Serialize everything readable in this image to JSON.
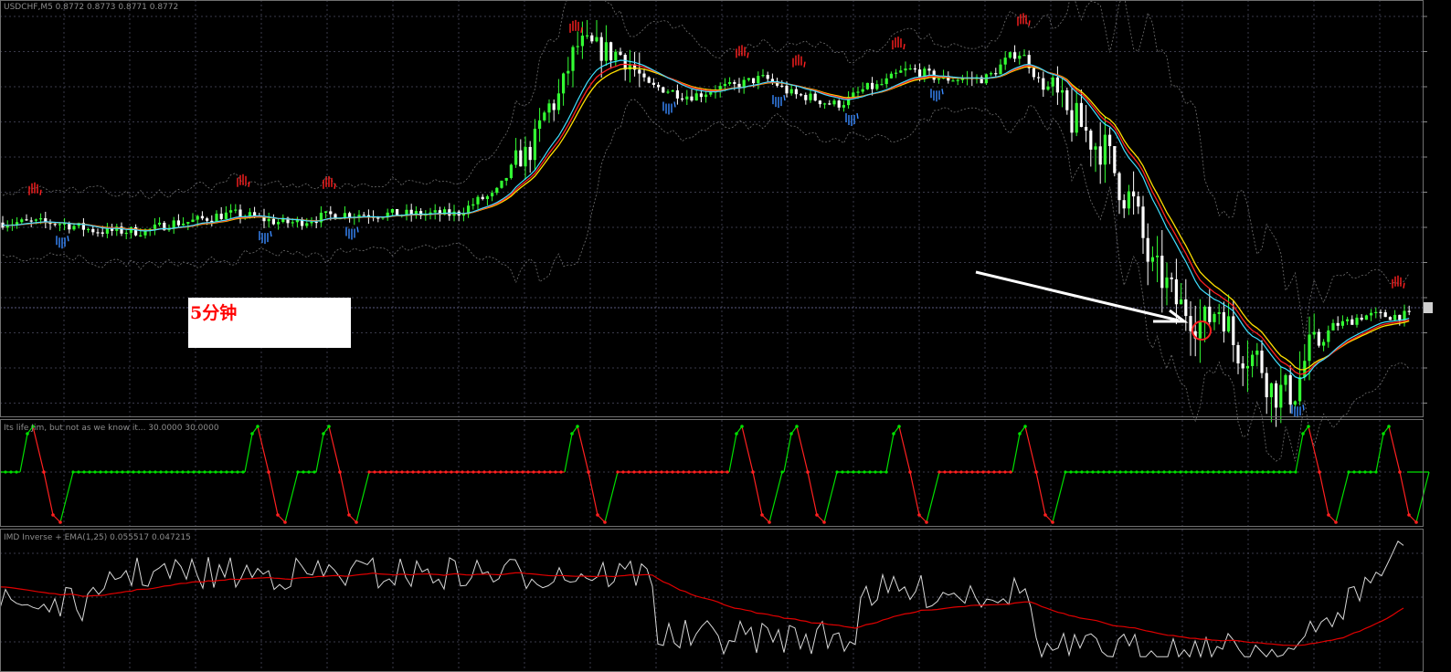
{
  "symbol_header": "USDCHF,M5  0.8772 0.8773 0.8771 0.8772",
  "overlay_text": "5分钟",
  "panel2_title": "Its life Jim, but not as we know it...  30.0000 30.0000",
  "panel3_title": "IMD Inverse + EMA(1,25) 0.055517 0.047215",
  "colors": {
    "background": "#000000",
    "grid": "#3a3a4a",
    "bull": "#33ff33",
    "bear": "#ffffff",
    "ma_fast": "#ff2020",
    "ma_slow": "#ffe000",
    "ma_cyan": "#40e0ff",
    "band": "#707070",
    "osc_up": "#00e000",
    "osc_down": "#ff2020",
    "line_white": "#d8d8d8",
    "line_red": "#e00000"
  },
  "chart_data": [
    {
      "type": "candlestick",
      "title": "USDCHF,M5",
      "series": [
        {
          "name": "price"
        },
        {
          "name": "MA"
        },
        {
          "name": "Bands"
        }
      ],
      "anchors": [
        [
          0,
          0.8772
        ],
        [
          60,
          0.8772
        ],
        [
          120,
          0.8771
        ],
        [
          160,
          0.8771
        ],
        [
          200,
          0.8772
        ],
        [
          260,
          0.8773
        ],
        [
          320,
          0.8772
        ],
        [
          380,
          0.8773
        ],
        [
          440,
          0.8773
        ],
        [
          500,
          0.8773
        ],
        [
          540,
          0.8775
        ],
        [
          580,
          0.878
        ],
        [
          610,
          0.8786
        ],
        [
          640,
          0.8793
        ],
        [
          680,
          0.8792
        ],
        [
          720,
          0.8788
        ],
        [
          760,
          0.8787
        ],
        [
          800,
          0.8788
        ],
        [
          840,
          0.8789
        ],
        [
          880,
          0.8787
        ],
        [
          920,
          0.8786
        ],
        [
          960,
          0.8788
        ],
        [
          1000,
          0.879
        ],
        [
          1040,
          0.8789
        ],
        [
          1080,
          0.8789
        ],
        [
          1120,
          0.8792
        ],
        [
          1150,
          0.8788
        ],
        [
          1180,
          0.8784
        ],
        [
          1210,
          0.8781
        ],
        [
          1240,
          0.8775
        ],
        [
          1270,
          0.8766
        ],
        [
          1300,
          0.8762
        ],
        [
          1320,
          0.876
        ],
        [
          1340,
          0.8762
        ],
        [
          1360,
          0.8757
        ],
        [
          1380,
          0.8756
        ],
        [
          1400,
          0.8752
        ],
        [
          1420,
          0.8752
        ],
        [
          1440,
          0.8757
        ],
        [
          1470,
          0.876
        ],
        [
          1500,
          0.8761
        ],
        [
          1540,
          0.8761
        ]
      ],
      "highs": [
        28,
        31,
        34,
        82,
        128,
        187,
        198,
        222,
        229,
        232,
        235,
        238,
        241,
        304,
        316,
        353,
        360
      ],
      "lows": [
        14,
        63,
        78,
        92,
        135,
        151,
        163,
        206,
        219,
        260,
        267,
        325,
        385,
        427,
        433,
        436,
        485,
        503,
        528,
        549,
        559
      ],
      "red_circle_at_x": 1315
    },
    {
      "type": "step",
      "title": "Its life Jim, but not as we know it...",
      "levels": [
        30.0,
        30.0
      ],
      "ylim": [
        0,
        100
      ]
    },
    {
      "type": "line",
      "title": "IMD Inverse + EMA(1,25)",
      "series": [
        {
          "name": "IMD Inverse",
          "value": 0.055517
        },
        {
          "name": "EMA(1,25)",
          "value": 0.047215
        }
      ]
    }
  ]
}
